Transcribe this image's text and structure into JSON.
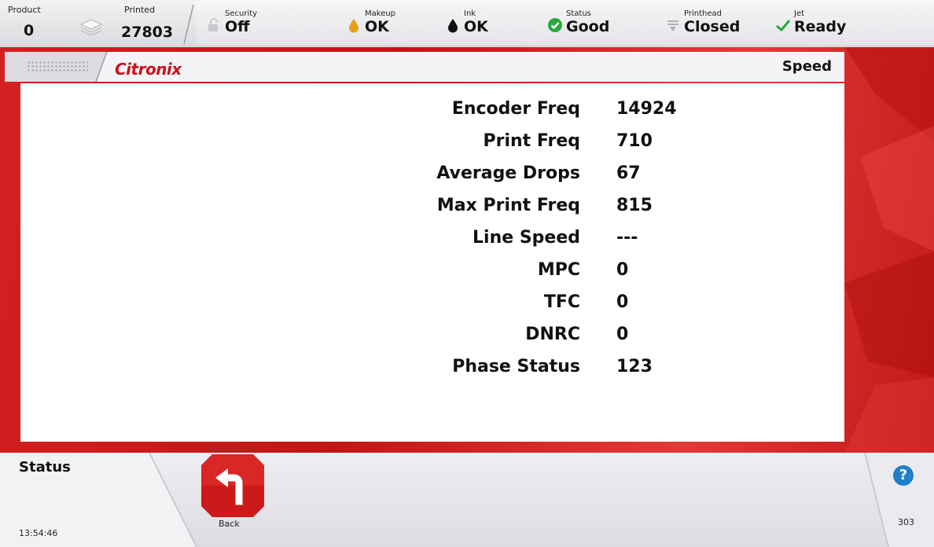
{
  "counters": {
    "product_label": "Product",
    "product_value": "0",
    "printed_label": "Printed",
    "printed_value": "27803"
  },
  "status": {
    "security": {
      "label": "Security",
      "value": "Off",
      "icon": "lock-open-icon"
    },
    "makeup": {
      "label": "Makeup",
      "value": "OK",
      "icon": "makeup-drop-icon",
      "color": "#e8a018"
    },
    "ink": {
      "label": "Ink",
      "value": "OK",
      "icon": "ink-drop-icon",
      "color": "#111111"
    },
    "system_status": {
      "label": "Status",
      "value": "Good",
      "icon": "check-circle-icon",
      "color": "#2aa83a"
    },
    "printhead": {
      "label": "Printhead",
      "value": "Closed",
      "icon": "printhead-icon"
    },
    "jet": {
      "label": "Jet",
      "value": "Ready",
      "icon": "checkmark-icon",
      "color": "#2aa83a"
    }
  },
  "header": {
    "logo": "Citronix",
    "page_title": "Speed"
  },
  "speed_rows": [
    {
      "label": "Encoder Freq",
      "value": "14924"
    },
    {
      "label": "Print Freq",
      "value": "710"
    },
    {
      "label": "Average Drops",
      "value": "67"
    },
    {
      "label": "Max Print Freq",
      "value": "815"
    },
    {
      "label": "Line Speed",
      "value": "---"
    },
    {
      "label": "MPC",
      "value": "0"
    },
    {
      "label": "TFC",
      "value": "0"
    },
    {
      "label": "DNRC",
      "value": "0"
    },
    {
      "label": "Phase Status",
      "value": "123"
    }
  ],
  "footer": {
    "status_label": "Status",
    "time": "13:54:46",
    "back_label": "Back",
    "help_glyph": "?",
    "code": "303"
  },
  "colors": {
    "frame_red": "#c11515",
    "button_red": "#cc1a1a",
    "help_blue": "#1f7fc8"
  }
}
